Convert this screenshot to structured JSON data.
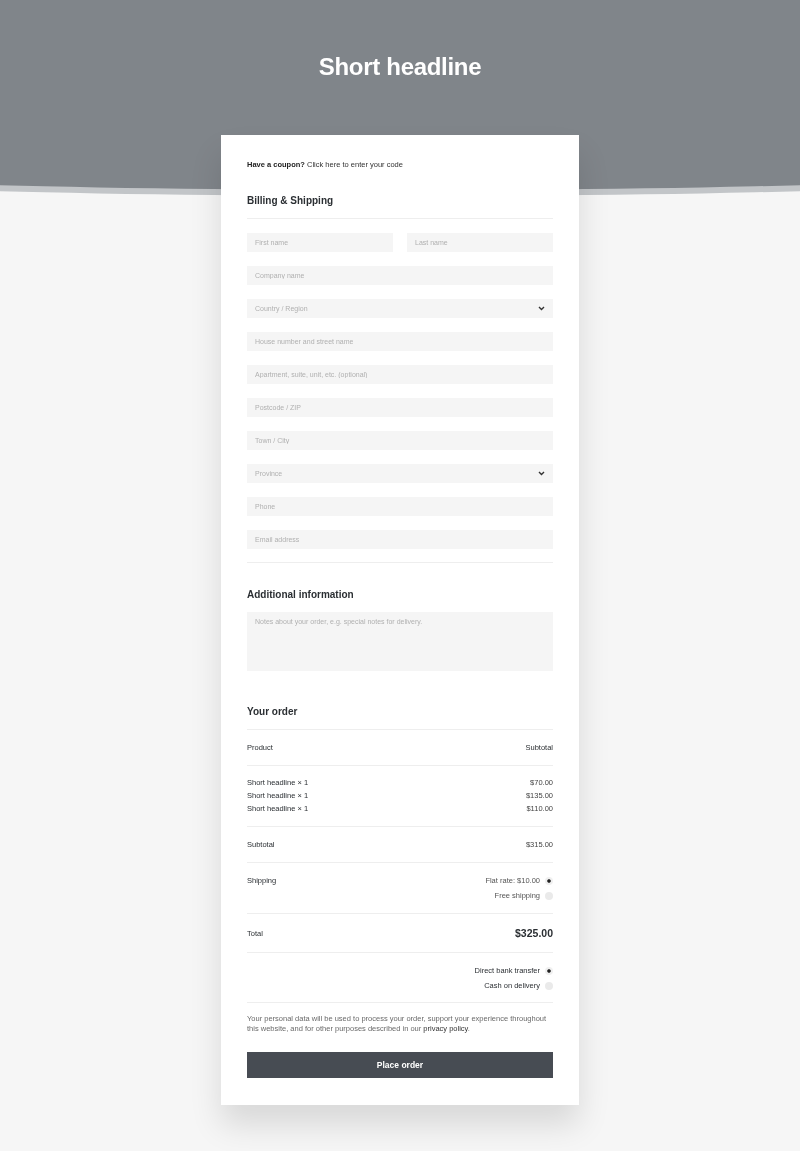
{
  "header": {
    "title": "Short headline"
  },
  "coupon": {
    "prompt": "Have a coupon?",
    "link": "Click here to enter your code"
  },
  "billing": {
    "heading": "Billing & Shipping",
    "rows": [
      [
        {
          "kind": "text",
          "placeholder": "First name"
        },
        {
          "kind": "text",
          "placeholder": "Last name"
        }
      ],
      [
        {
          "kind": "text",
          "placeholder": "Company name"
        }
      ],
      [
        {
          "kind": "select",
          "placeholder": "Country / Region"
        }
      ],
      [
        {
          "kind": "text",
          "placeholder": "House number and street name"
        }
      ],
      [
        {
          "kind": "text",
          "placeholder": "Apartment, suite, unit, etc. (optional)"
        }
      ],
      [
        {
          "kind": "text",
          "placeholder": "Postcode / ZIP"
        }
      ],
      [
        {
          "kind": "text",
          "placeholder": "Town / City"
        }
      ],
      [
        {
          "kind": "select",
          "placeholder": "Province"
        }
      ],
      [
        {
          "kind": "text",
          "placeholder": "Phone"
        }
      ],
      [
        {
          "kind": "text",
          "placeholder": "Email address"
        }
      ]
    ]
  },
  "additional": {
    "heading": "Additional information",
    "notes": {
      "placeholder": "Notes about your order, e.g. special notes for delivery."
    }
  },
  "order": {
    "heading": "Your order",
    "columns": [
      "Product",
      "Subtotal"
    ],
    "items": [
      {
        "name": "Short headline × 1",
        "price": "$70.00"
      },
      {
        "name": "Short headline × 1",
        "price": "$135.00"
      },
      {
        "name": "Short headline × 1",
        "price": "$110.00"
      }
    ],
    "subtotal": {
      "label": "Subtotal",
      "value": "$315.00"
    },
    "shipping": {
      "label": "Shipping",
      "options": [
        {
          "label": "Flat rate: $10.00",
          "selected": true
        },
        {
          "label": "Free shipping",
          "selected": false
        }
      ]
    },
    "total": {
      "label": "Total",
      "value": "$325.00"
    }
  },
  "payment": {
    "options": [
      {
        "label": "Direct bank transfer",
        "selected": true
      },
      {
        "label": "Cash on delivery",
        "selected": false
      }
    ]
  },
  "privacy": {
    "before": "Your personal data will be used to process your order, support your experience throughout this website, and for other purposes described in our ",
    "link": "privacy policy",
    "after": "."
  },
  "place_order": "Place order"
}
